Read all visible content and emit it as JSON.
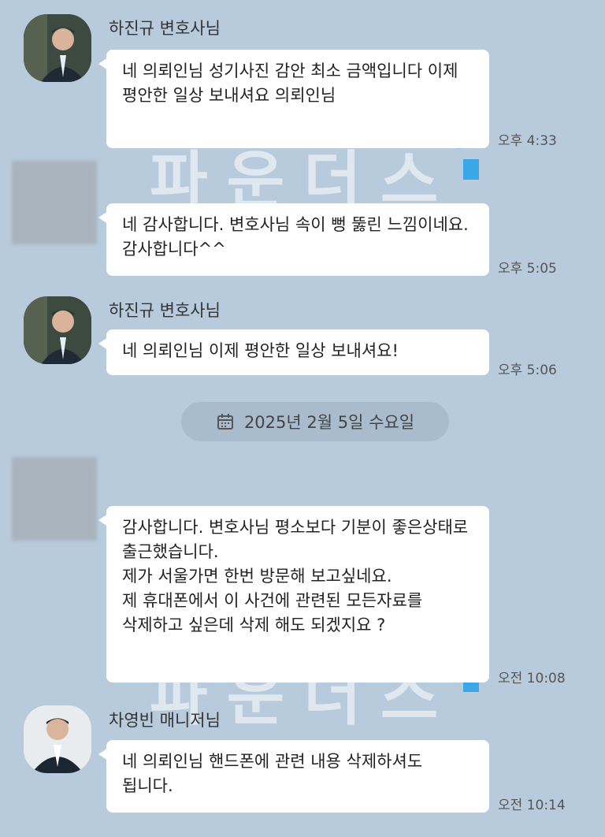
{
  "chat": {
    "messages": [
      {
        "sender": "하진규 변호사님",
        "text": "네 의뢰인님 성기사진 감안 최소 금액입니다 이제 평안한 일상 보내셔요 의뢰인님",
        "time": "오후 4:33"
      },
      {
        "sender": "",
        "text": "네 감사합니다. 변호사님 속이 뻥 뚫린 느낌이네요. 감사합니다^^",
        "time": "오후 5:05"
      },
      {
        "sender": "하진규 변호사님",
        "text": "네 의뢰인님 이제 평안한 일상 보내셔요!",
        "time": "오후 5:06"
      },
      {
        "sender": "",
        "text": "감사합니다. 변호사님 평소보다 기분이 좋은상태로 출근했습니다.\n제가 서울가면 한번 방문해 보고싶네요.\n제 휴대폰에서 이 사건에 관련된 모든자료를 삭제하고 싶은데 삭제 해도 되겠지요 ?",
        "time": "오전 10:08"
      },
      {
        "sender": "차영빈 매니저님",
        "text": "네 의뢰인님 핸드폰에 관련 내용 삭제하셔도 됩니다.",
        "time": "오전 10:14"
      }
    ],
    "date_divider": "2025년 2월 5일 수요일",
    "watermark": "파운더스"
  },
  "icons": {
    "calendar": "calendar-icon"
  },
  "colors": {
    "background": "#b8cbdc",
    "bubble": "#ffffff",
    "date_pill": "#a9bccd"
  }
}
